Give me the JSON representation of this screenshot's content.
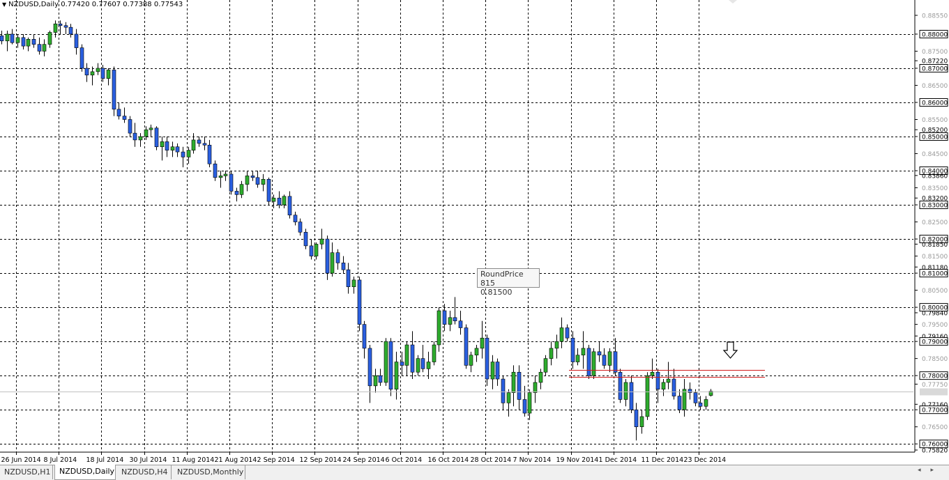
{
  "header": {
    "symbol": "NZDUSD,Daily",
    "ohlc": "0.77420 0.77607 0.77388 0.77543"
  },
  "tooltip": {
    "line1": "RoundPrice 815",
    "line2": "0.81500"
  },
  "tabs": [
    {
      "label": "NZDUSD,H1",
      "active": false
    },
    {
      "label": "NZDUSD,Daily",
      "active": true
    },
    {
      "label": "NZDUSD,H4",
      "active": false
    },
    {
      "label": "NZDUSD,Monthly",
      "active": false
    }
  ],
  "colors": {
    "bull": "#2eac2e",
    "bear": "#2a5fe0",
    "grid_major": "#000000",
    "grid_minor": "#b0b0b0",
    "resistance": "#d11a1a",
    "bid": "#c0c0c0"
  },
  "icons": {
    "down_arrow": "down-arrow-icon",
    "close_corner": "corner-icon"
  },
  "chart_data": {
    "type": "candlestick",
    "symbol": "NZDUSD",
    "timeframe": "Daily",
    "ylim": [
      0.7582,
      0.8855
    ],
    "x_tick_labels": [
      "26 Jun 2014",
      "8 Jul 2014",
      "18 Jul 2014",
      "30 Jul 2014",
      "11 Aug 2014",
      "21 Aug 2014",
      "2 Sep 2014",
      "12 Sep 2014",
      "24 Sep 2014",
      "6 Oct 2014",
      "16 Oct 2014",
      "28 Oct 2014",
      "7 Nov 2014",
      "19 Nov 2014",
      "1 Dec 2014",
      "11 Dec 2014",
      "23 Dec 2014"
    ],
    "y_ticks_major": [
      0.88,
      0.87,
      0.86,
      0.85,
      0.84,
      0.83,
      0.82,
      0.81,
      0.8,
      0.79,
      0.78,
      0.77,
      0.76
    ],
    "y_tick_labels": [
      {
        "v": 0.8855,
        "t": "0.88550",
        "s": "minor"
      },
      {
        "v": 0.88,
        "t": "0.88000",
        "s": "major"
      },
      {
        "v": 0.875,
        "t": "0.87500",
        "s": "minor"
      },
      {
        "v": 0.8722,
        "t": "0.87220",
        "s": "plain"
      },
      {
        "v": 0.87,
        "t": "0.87000",
        "s": "major"
      },
      {
        "v": 0.865,
        "t": "0.86500",
        "s": "minor"
      },
      {
        "v": 0.86,
        "t": "0.86000",
        "s": "major"
      },
      {
        "v": 0.855,
        "t": "0.85500",
        "s": "minor"
      },
      {
        "v": 0.852,
        "t": "0.85200",
        "s": "plain"
      },
      {
        "v": 0.85,
        "t": "0.85000",
        "s": "major"
      },
      {
        "v": 0.845,
        "t": "0.84500",
        "s": "minor"
      },
      {
        "v": 0.84,
        "t": "0.84000",
        "s": "major"
      },
      {
        "v": 0.8386,
        "t": "0.83860",
        "s": "plain"
      },
      {
        "v": 0.835,
        "t": "0.83500",
        "s": "minor"
      },
      {
        "v": 0.832,
        "t": "0.83200",
        "s": "plain"
      },
      {
        "v": 0.83,
        "t": "0.83000",
        "s": "major"
      },
      {
        "v": 0.825,
        "t": "0.82500",
        "s": "minor"
      },
      {
        "v": 0.82,
        "t": "0.82000",
        "s": "major"
      },
      {
        "v": 0.8185,
        "t": "0.81850",
        "s": "plain"
      },
      {
        "v": 0.815,
        "t": "0.81500",
        "s": "minor"
      },
      {
        "v": 0.8118,
        "t": "0.81180",
        "s": "plain"
      },
      {
        "v": 0.81,
        "t": "0.81000",
        "s": "major"
      },
      {
        "v": 0.805,
        "t": "0.80500",
        "s": "minor"
      },
      {
        "v": 0.8,
        "t": "0.80000",
        "s": "major"
      },
      {
        "v": 0.7984,
        "t": "0.79840",
        "s": "plain"
      },
      {
        "v": 0.795,
        "t": "0.79500",
        "s": "minor"
      },
      {
        "v": 0.7916,
        "t": "0.79160",
        "s": "plain"
      },
      {
        "v": 0.79,
        "t": "0.79000",
        "s": "major"
      },
      {
        "v": 0.785,
        "t": "0.78500",
        "s": "minor"
      },
      {
        "v": 0.78,
        "t": "0.78000",
        "s": "major"
      },
      {
        "v": 0.7775,
        "t": "0.77750",
        "s": "minor"
      },
      {
        "v": 0.7716,
        "t": "0.77160",
        "s": "plain"
      },
      {
        "v": 0.77,
        "t": "0.77000",
        "s": "major"
      },
      {
        "v": 0.765,
        "t": "0.76500",
        "s": "minor"
      },
      {
        "v": 0.76,
        "t": "0.76000",
        "s": "major"
      },
      {
        "v": 0.7582,
        "t": "0.75820",
        "s": "plain"
      }
    ],
    "resistance_lines": [
      0.7817,
      0.7796
    ],
    "bid": 0.77543,
    "candles": [
      [
        0.8795,
        0.881,
        0.877,
        0.878
      ],
      [
        0.878,
        0.881,
        0.875,
        0.88
      ],
      [
        0.88,
        0.8815,
        0.877,
        0.8775
      ],
      [
        0.8775,
        0.88,
        0.876,
        0.879
      ],
      [
        0.879,
        0.88,
        0.8755,
        0.8765
      ],
      [
        0.8765,
        0.879,
        0.875,
        0.8785
      ],
      [
        0.8785,
        0.88,
        0.876,
        0.877
      ],
      [
        0.877,
        0.879,
        0.874,
        0.875
      ],
      [
        0.875,
        0.8785,
        0.8735,
        0.877
      ],
      [
        0.877,
        0.881,
        0.876,
        0.8805
      ],
      [
        0.8805,
        0.884,
        0.879,
        0.883
      ],
      [
        0.883,
        0.884,
        0.88,
        0.8825
      ],
      [
        0.8825,
        0.8835,
        0.88,
        0.882
      ],
      [
        0.882,
        0.883,
        0.879,
        0.88
      ],
      [
        0.88,
        0.8815,
        0.874,
        0.876
      ],
      [
        0.876,
        0.877,
        0.869,
        0.87
      ],
      [
        0.87,
        0.8715,
        0.866,
        0.868
      ],
      [
        0.868,
        0.8705,
        0.865,
        0.869
      ],
      [
        0.869,
        0.8715,
        0.868,
        0.87
      ],
      [
        0.87,
        0.871,
        0.866,
        0.867
      ],
      [
        0.867,
        0.87,
        0.865,
        0.8695
      ],
      [
        0.8695,
        0.8705,
        0.856,
        0.858
      ],
      [
        0.858,
        0.86,
        0.855,
        0.856
      ],
      [
        0.856,
        0.8585,
        0.854,
        0.855
      ],
      [
        0.855,
        0.856,
        0.85,
        0.851
      ],
      [
        0.851,
        0.854,
        0.847,
        0.849
      ],
      [
        0.849,
        0.851,
        0.847,
        0.85
      ],
      [
        0.85,
        0.853,
        0.849,
        0.852
      ],
      [
        0.852,
        0.8535,
        0.85,
        0.8525
      ],
      [
        0.8525,
        0.853,
        0.846,
        0.847
      ],
      [
        0.847,
        0.85,
        0.843,
        0.8485
      ],
      [
        0.8485,
        0.85,
        0.844,
        0.846
      ],
      [
        0.846,
        0.8485,
        0.844,
        0.847
      ],
      [
        0.847,
        0.848,
        0.844,
        0.8455
      ],
      [
        0.8455,
        0.847,
        0.841,
        0.844
      ],
      [
        0.844,
        0.847,
        0.842,
        0.846
      ],
      [
        0.846,
        0.851,
        0.845,
        0.849
      ],
      [
        0.849,
        0.85,
        0.847,
        0.848
      ],
      [
        0.848,
        0.85,
        0.846,
        0.8475
      ],
      [
        0.8475,
        0.849,
        0.841,
        0.842
      ],
      [
        0.842,
        0.843,
        0.837,
        0.838
      ],
      [
        0.838,
        0.84,
        0.835,
        0.8385
      ],
      [
        0.8385,
        0.84,
        0.837,
        0.839
      ],
      [
        0.839,
        0.84,
        0.833,
        0.834
      ],
      [
        0.834,
        0.835,
        0.831,
        0.833
      ],
      [
        0.833,
        0.837,
        0.832,
        0.836
      ],
      [
        0.836,
        0.84,
        0.834,
        0.8385
      ],
      [
        0.8385,
        0.84,
        0.837,
        0.838
      ],
      [
        0.838,
        0.84,
        0.835,
        0.836
      ],
      [
        0.836,
        0.839,
        0.834,
        0.8375
      ],
      [
        0.8375,
        0.838,
        0.83,
        0.831
      ],
      [
        0.831,
        0.833,
        0.829,
        0.832
      ],
      [
        0.832,
        0.834,
        0.829,
        0.83
      ],
      [
        0.83,
        0.833,
        0.829,
        0.8325
      ],
      [
        0.8325,
        0.834,
        0.826,
        0.827
      ],
      [
        0.827,
        0.828,
        0.824,
        0.825
      ],
      [
        0.825,
        0.826,
        0.821,
        0.822
      ],
      [
        0.822,
        0.823,
        0.817,
        0.818
      ],
      [
        0.818,
        0.82,
        0.814,
        0.815
      ],
      [
        0.815,
        0.819,
        0.814,
        0.8185
      ],
      [
        0.8185,
        0.823,
        0.817,
        0.82
      ],
      [
        0.82,
        0.821,
        0.808,
        0.81
      ],
      [
        0.81,
        0.819,
        0.809,
        0.816
      ],
      [
        0.816,
        0.817,
        0.811,
        0.813
      ],
      [
        0.813,
        0.815,
        0.81,
        0.811
      ],
      [
        0.811,
        0.813,
        0.804,
        0.806
      ],
      [
        0.806,
        0.809,
        0.804,
        0.808
      ],
      [
        0.808,
        0.809,
        0.793,
        0.795
      ],
      [
        0.795,
        0.796,
        0.785,
        0.788
      ],
      [
        0.788,
        0.789,
        0.772,
        0.777
      ],
      [
        0.777,
        0.782,
        0.775,
        0.78
      ],
      [
        0.78,
        0.782,
        0.777,
        0.778
      ],
      [
        0.778,
        0.791,
        0.777,
        0.79
      ],
      [
        0.79,
        0.791,
        0.774,
        0.776
      ],
      [
        0.776,
        0.787,
        0.773,
        0.784
      ],
      [
        0.784,
        0.787,
        0.78,
        0.783
      ],
      [
        0.783,
        0.79,
        0.78,
        0.789
      ],
      [
        0.789,
        0.793,
        0.779,
        0.781
      ],
      [
        0.781,
        0.786,
        0.78,
        0.785
      ],
      [
        0.785,
        0.789,
        0.781,
        0.782
      ],
      [
        0.782,
        0.787,
        0.779,
        0.784
      ],
      [
        0.784,
        0.79,
        0.783,
        0.789
      ],
      [
        0.789,
        0.8,
        0.787,
        0.799
      ],
      [
        0.799,
        0.801,
        0.793,
        0.795
      ],
      [
        0.795,
        0.799,
        0.793,
        0.797
      ],
      [
        0.797,
        0.803,
        0.795,
        0.796
      ],
      [
        0.796,
        0.799,
        0.792,
        0.794
      ],
      [
        0.794,
        0.795,
        0.782,
        0.783
      ],
      [
        0.783,
        0.787,
        0.781,
        0.786
      ],
      [
        0.786,
        0.789,
        0.784,
        0.788
      ],
      [
        0.788,
        0.796,
        0.785,
        0.791
      ],
      [
        0.791,
        0.792,
        0.777,
        0.779
      ],
      [
        0.779,
        0.786,
        0.776,
        0.784
      ],
      [
        0.784,
        0.785,
        0.777,
        0.779
      ],
      [
        0.779,
        0.78,
        0.77,
        0.772
      ],
      [
        0.772,
        0.776,
        0.768,
        0.775
      ],
      [
        0.775,
        0.783,
        0.771,
        0.781
      ],
      [
        0.781,
        0.783,
        0.77,
        0.773
      ],
      [
        0.773,
        0.777,
        0.768,
        0.769
      ],
      [
        0.769,
        0.776,
        0.767,
        0.775
      ],
      [
        0.775,
        0.78,
        0.772,
        0.778
      ],
      [
        0.778,
        0.782,
        0.776,
        0.781
      ],
      [
        0.781,
        0.786,
        0.78,
        0.785
      ],
      [
        0.785,
        0.79,
        0.783,
        0.788
      ],
      [
        0.788,
        0.792,
        0.785,
        0.79
      ],
      [
        0.79,
        0.797,
        0.788,
        0.794
      ],
      [
        0.794,
        0.795,
        0.79,
        0.791
      ],
      [
        0.791,
        0.793,
        0.782,
        0.784
      ],
      [
        0.784,
        0.788,
        0.783,
        0.786
      ],
      [
        0.786,
        0.793,
        0.782,
        0.788
      ],
      [
        0.788,
        0.789,
        0.779,
        0.78
      ],
      [
        0.78,
        0.788,
        0.779,
        0.787
      ],
      [
        0.787,
        0.79,
        0.784,
        0.786
      ],
      [
        0.786,
        0.788,
        0.782,
        0.783
      ],
      [
        0.783,
        0.788,
        0.781,
        0.787
      ],
      [
        0.787,
        0.791,
        0.78,
        0.781
      ],
      [
        0.781,
        0.782,
        0.772,
        0.773
      ],
      [
        0.773,
        0.779,
        0.771,
        0.778
      ],
      [
        0.778,
        0.78,
        0.769,
        0.77
      ],
      [
        0.77,
        0.772,
        0.761,
        0.765
      ],
      [
        0.765,
        0.77,
        0.763,
        0.768
      ],
      [
        0.768,
        0.781,
        0.767,
        0.78
      ],
      [
        0.78,
        0.785,
        0.779,
        0.781
      ],
      [
        0.781,
        0.782,
        0.772,
        0.776
      ],
      [
        0.776,
        0.779,
        0.774,
        0.778
      ],
      [
        0.778,
        0.784,
        0.776,
        0.779
      ],
      [
        0.779,
        0.782,
        0.773,
        0.774
      ],
      [
        0.774,
        0.776,
        0.769,
        0.77
      ],
      [
        0.77,
        0.779,
        0.768,
        0.776
      ],
      [
        0.776,
        0.778,
        0.773,
        0.775
      ],
      [
        0.775,
        0.776,
        0.771,
        0.772
      ],
      [
        0.772,
        0.774,
        0.77,
        0.771
      ],
      [
        0.771,
        0.774,
        0.77,
        0.773
      ],
      [
        0.7742,
        0.77607,
        0.77388,
        0.77543
      ]
    ]
  }
}
